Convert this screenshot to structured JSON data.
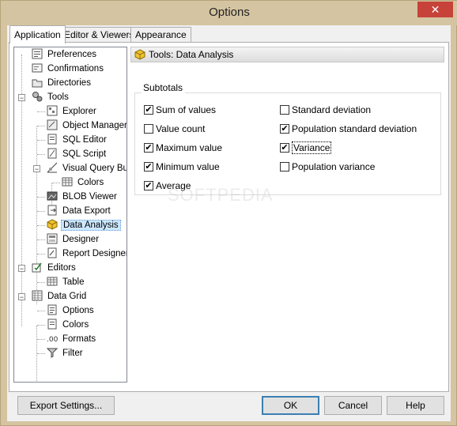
{
  "window": {
    "title": "Options",
    "close_glyph": "✕"
  },
  "tabs": [
    {
      "label": "Application",
      "active": true
    },
    {
      "label": "Editor & Viewers",
      "active": false
    },
    {
      "label": "Appearance",
      "active": false
    }
  ],
  "tree": {
    "items": [
      {
        "label": "Preferences",
        "icon": "preferences-icon"
      },
      {
        "label": "Confirmations",
        "icon": "confirmations-icon"
      },
      {
        "label": "Directories",
        "icon": "directories-icon"
      },
      {
        "label": "Tools",
        "icon": "tools-icon",
        "expanded": true
      },
      {
        "label": "Explorer",
        "icon": "explorer-icon"
      },
      {
        "label": "Object Manager",
        "icon": "object-manager-icon"
      },
      {
        "label": "SQL Editor",
        "icon": "sql-editor-icon"
      },
      {
        "label": "SQL Script",
        "icon": "sql-script-icon"
      },
      {
        "label": "Visual Query Builder",
        "icon": "visual-query-builder-icon",
        "expanded": true
      },
      {
        "label": "Colors",
        "icon": "colors-icon"
      },
      {
        "label": "BLOB Viewer",
        "icon": "blob-viewer-icon"
      },
      {
        "label": "Data Export",
        "icon": "data-export-icon"
      },
      {
        "label": "Data Analysis",
        "icon": "data-analysis-icon",
        "selected": true
      },
      {
        "label": "Designer",
        "icon": "designer-icon"
      },
      {
        "label": "Report Designer",
        "icon": "report-designer-icon"
      },
      {
        "label": "Editors",
        "icon": "editors-icon",
        "expanded": true
      },
      {
        "label": "Table",
        "icon": "table-icon"
      },
      {
        "label": "Data Grid",
        "icon": "data-grid-icon",
        "expanded": true
      },
      {
        "label": "Options",
        "icon": "options-icon"
      },
      {
        "label": "Colors",
        "icon": "colors-icon"
      },
      {
        "label": "Formats",
        "icon": "formats-icon"
      },
      {
        "label": "Filter",
        "icon": "filter-icon"
      }
    ]
  },
  "panel": {
    "header": "Tools: Data Analysis",
    "group_title": "Subtotals",
    "checkboxes": [
      {
        "label": "Sum of values",
        "checked": true
      },
      {
        "label": "Value count",
        "checked": false
      },
      {
        "label": "Maximum value",
        "checked": true
      },
      {
        "label": "Minimum value",
        "checked": true
      },
      {
        "label": "Average",
        "checked": true
      },
      {
        "label": "Standard deviation",
        "checked": false
      },
      {
        "label": "Population standard deviation",
        "checked": true
      },
      {
        "label": "Variance",
        "checked": true,
        "focused": true
      },
      {
        "label": "Population variance",
        "checked": false
      }
    ]
  },
  "buttons": {
    "export": "Export Settings...",
    "ok": "OK",
    "cancel": "Cancel",
    "help": "Help"
  },
  "watermark": "SOFTPEDIA",
  "colors": {
    "title_bg": "#d5c4a1",
    "close_bg": "#c7433a",
    "selection_bg": "#cce8ff"
  }
}
